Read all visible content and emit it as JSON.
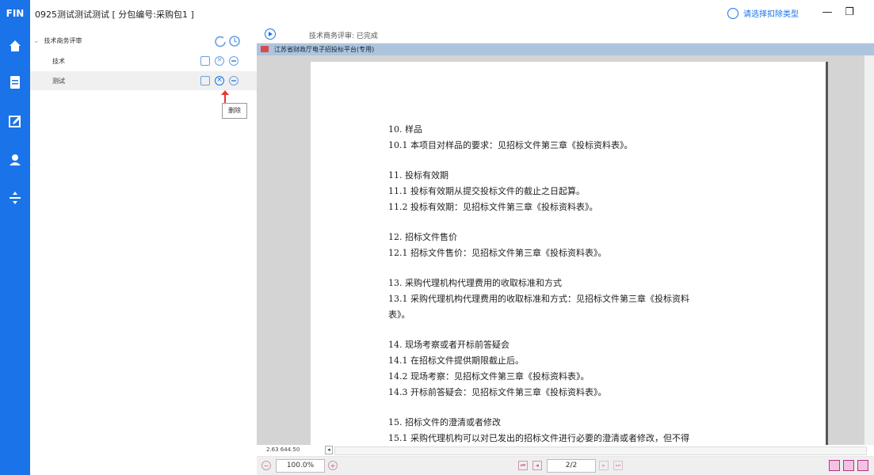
{
  "app": {
    "logo": "FIN",
    "window_title": "0925测试测试测试 [ 分包编号:采购包1 ]"
  },
  "header": {
    "package_type_label": "请选择扣除类型",
    "minimize": "—",
    "restore": "❐"
  },
  "rail": {
    "items": [
      "home-icon",
      "document-icon",
      "edit-icon",
      "user-icon",
      "split-icon"
    ]
  },
  "tree": {
    "root_label": "技术商务评审",
    "items": [
      {
        "label": "技术"
      },
      {
        "label": "测试"
      }
    ],
    "tooltip": "删除"
  },
  "status": {
    "text": "技术商务评审: 已完成"
  },
  "document": {
    "tab_title": "江苏省财政厅电子招投标平台(专用)",
    "lines": [
      "10. 样品",
      "10.1 本项目对样品的要求：见招标文件第三章《投标资料表》。",
      "",
      "11. 投标有效期",
      "11.1 投标有效期从提交投标文件的截止之日起算。",
      "11.2 投标有效期：见招标文件第三章《投标资料表》。",
      "",
      "12. 招标文件售价",
      "12.1 招标文件售价：见招标文件第三章《投标资料表》。",
      "",
      "13. 采购代理机构代理费用的收取标准和方式",
      "13.1 采购代理机构代理费用的收取标准和方式：见招标文件第三章《投标资料",
      "表》。",
      "",
      "14. 现场考察或者开标前答疑会",
      "14.1 在招标文件提供期限截止后。",
      "14.2 现场考察：见招标文件第三章《投标资料表》。",
      "14.3 开标前答疑会：见招标文件第三章《投标资料表》。",
      "",
      "15. 招标文件的澄清或者修改",
      "15.1 采购代理机构可以对已发出的招标文件进行必要的澄清或者修改，但不得"
    ]
  },
  "viewer": {
    "coordinates": "2.63 644.50",
    "zoom": "100.0%",
    "page_indicator": "2/2"
  }
}
